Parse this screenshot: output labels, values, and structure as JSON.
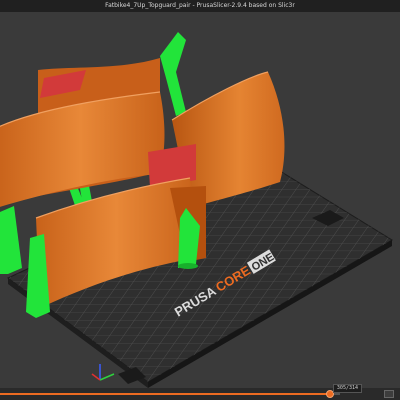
{
  "window": {
    "title": "Fatbike4_7Up_Topguard_pair - PrusaSlicer-2.9.4 based on Slic3r"
  },
  "bed": {
    "brand_prusa": "PRUSA",
    "brand_core": "CORE",
    "brand_one": "ONE"
  },
  "viewport": {
    "axes_icon": "xyz-axes-icon"
  },
  "layer_slider": {
    "value_label": "305/314",
    "fraction": 0.97
  },
  "colors": {
    "model": "#e07e30",
    "support": "#22e43a",
    "overhang": "#d23a3a",
    "bed": "#2f2f2f",
    "accent": "#ed6b21"
  }
}
